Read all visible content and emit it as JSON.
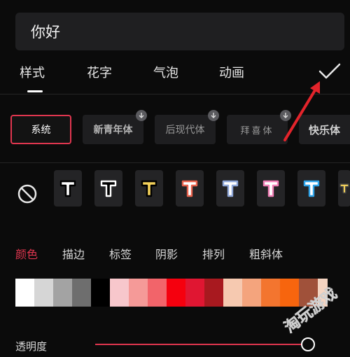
{
  "input": {
    "value": "你好"
  },
  "tabs": [
    {
      "label": "样式",
      "active": true
    },
    {
      "label": "花字"
    },
    {
      "label": "气泡"
    },
    {
      "label": "动画"
    }
  ],
  "fonts": [
    {
      "label": "系统",
      "selected": true
    },
    {
      "label": "新青年体",
      "downloadable": true
    },
    {
      "label": "后现代体",
      "downloadable": true
    },
    {
      "label": "拜喜体",
      "downloadable": true
    },
    {
      "label": "快乐体"
    }
  ],
  "presets": [
    {
      "fill": "#ffffff",
      "stroke": "#000000"
    },
    {
      "fill": "#000000",
      "stroke": "#ffffff"
    },
    {
      "fill": "#f3d15a",
      "stroke": "#000000"
    },
    {
      "fill": "#ffffff",
      "stroke": "#e8624d"
    },
    {
      "fill": "#ffffff",
      "stroke": "#8fa7d8"
    },
    {
      "fill": "#ffffff",
      "stroke": "#ef7fb5"
    },
    {
      "fill": "#ffffff",
      "stroke": "#2fa3e8"
    },
    {
      "fill": "#f3d15a",
      "stroke": "#444444"
    }
  ],
  "subtabs": [
    {
      "label": "颜色",
      "active": true
    },
    {
      "label": "描边"
    },
    {
      "label": "标签"
    },
    {
      "label": "阴影"
    },
    {
      "label": "排列"
    },
    {
      "label": "粗斜体"
    }
  ],
  "colors": [
    "#ffffff",
    "#d6d6d6",
    "#a3a3a3",
    "#6e6e6e",
    "#000000",
    "#f7c7cc",
    "#f59a98",
    "#f2646a",
    "#f5000e",
    "#e01632",
    "#a8191f",
    "#f6c9b0",
    "#f4a47d",
    "#f3752f",
    "#f7650e",
    "#a0513a",
    "#f4d4c1"
  ],
  "opacity": {
    "label": "透明度",
    "value": 0.95
  },
  "accent": "#e0364f",
  "watermark": "淘玩游戏"
}
